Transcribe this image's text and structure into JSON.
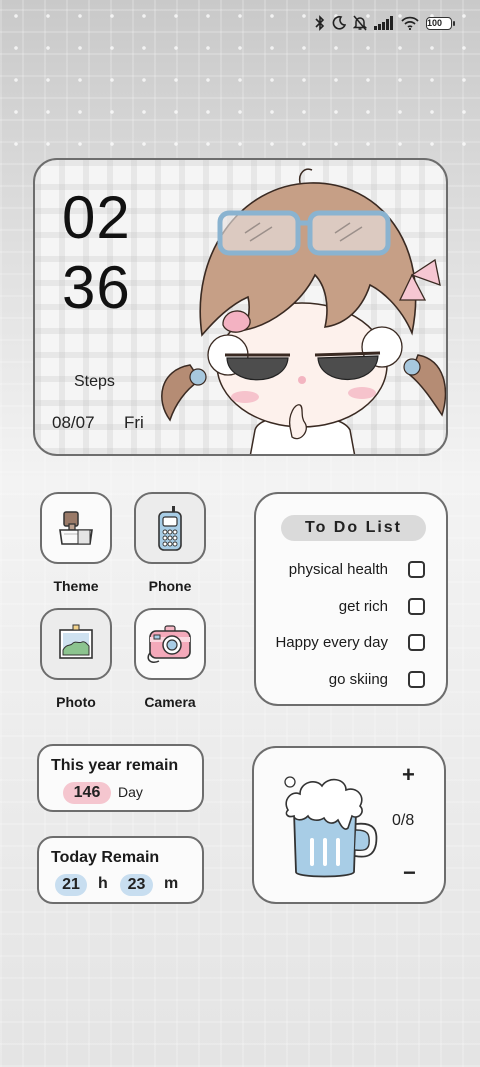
{
  "status_bar": {
    "icons": [
      "bluetooth-icon",
      "moon-icon",
      "mute-bell-icon",
      "signal-icon",
      "wifi-icon"
    ],
    "battery": "100"
  },
  "clock_widget": {
    "hour": "02",
    "minute": "36",
    "steps_label": "Steps",
    "date": "08/07",
    "weekday": "Fri"
  },
  "apps": [
    {
      "label": "Theme",
      "icon": "scraper-brush-icon"
    },
    {
      "label": "Phone",
      "icon": "mobile-phone-icon"
    },
    {
      "label": "Photo",
      "icon": "photo-frame-icon"
    },
    {
      "label": "Camera",
      "icon": "camera-icon"
    }
  ],
  "todo": {
    "title": "To Do List",
    "items": [
      "physical health",
      "get rich",
      "Happy every day",
      "go skiing"
    ]
  },
  "year_remain": {
    "title": "This year remain",
    "value": "146",
    "unit": "Day"
  },
  "today_remain": {
    "title": "Today Remain",
    "hours": "21",
    "hours_unit": "h",
    "minutes": "23",
    "minutes_unit": "m"
  },
  "water_counter": {
    "plus": "+",
    "count": "0/8",
    "minus": "−"
  },
  "colors": {
    "pink_pill": "#f5c6cf",
    "blue_pill": "#c8def0",
    "card_border": "#6d6d6d"
  }
}
